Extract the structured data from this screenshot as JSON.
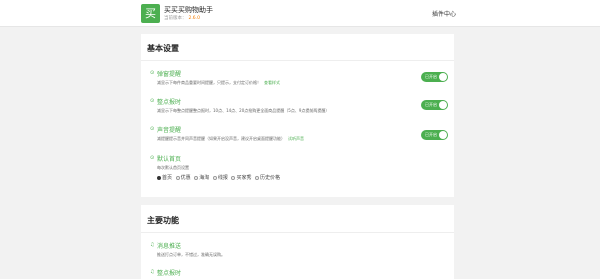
{
  "header": {
    "logo_char": "买",
    "app_title": "买买买购物助手",
    "version_label": "当前版本：",
    "version_number": "2.6.0",
    "plugin_center": "插件中心"
  },
  "basic": {
    "title": "基本设置",
    "items": [
      {
        "icon": "⊙",
        "title": "弹窗提醒",
        "desc": "减显示下每件商品重要时间提醒，只提示，支付定订价格！",
        "link": "查看样式",
        "toggle_label": "已开启"
      },
      {
        "icon": "⊙",
        "title": "整点报时",
        "desc": "减显示下每整点提醒整点报时，10点、14点、20点抢购更全面商品提醒（5点、9点提前两提醒）",
        "link": "",
        "toggle_label": "已开启"
      },
      {
        "icon": "⊙",
        "title": "声音提醒",
        "desc": "减提醒提示音并同声音提醒（如果开启没声音，建议开启桌面提醒功能）",
        "link": "试听声音",
        "toggle_label": "已开启"
      },
      {
        "icon": "⊙",
        "title": "默认首页",
        "desc": "每次默认首页设置",
        "link": ""
      }
    ],
    "radio_options": [
      "首页",
      "优惠",
      "海淘",
      "线报",
      "买家秀",
      "历史价格"
    ],
    "radio_selected_index": 0
  },
  "main": {
    "title": "主要功能",
    "items": [
      {
        "icon": "♫",
        "title": "消息推送",
        "desc": "推送打点订单，不错过，准确无误购。"
      },
      {
        "icon": "♫",
        "title": "整点报时",
        "desc": ""
      }
    ]
  },
  "colors": {
    "accent": "#4caf50",
    "version": "#f57c00"
  }
}
